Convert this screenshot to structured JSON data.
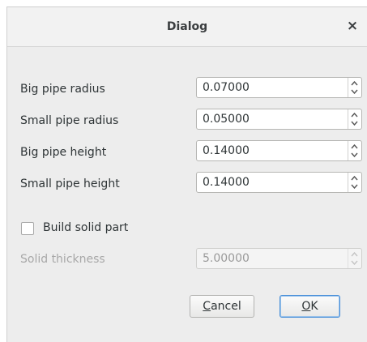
{
  "window": {
    "title": "Dialog",
    "close_glyph": "×"
  },
  "fields": [
    {
      "label": "Big pipe radius",
      "value": "0.07000"
    },
    {
      "label": "Small pipe radius",
      "value": "0.05000"
    },
    {
      "label": "Big pipe height",
      "value": "0.14000"
    },
    {
      "label": "Small pipe height",
      "value": "0.14000"
    }
  ],
  "solid": {
    "checkbox_label": "Build solid part",
    "checked": false,
    "thickness_label": "Solid thickness",
    "thickness_value": "5.00000",
    "thickness_enabled": false
  },
  "buttons": {
    "cancel_mnemonic": "C",
    "cancel_rest": "ancel",
    "ok_mnemonic": "O",
    "ok_rest": "K"
  },
  "icons": {
    "close": "close-icon",
    "spin_up": "arrow-up-icon",
    "spin_down": "arrow-down-icon"
  },
  "colors": {
    "focus_border": "#4a90d9",
    "disabled_text": "#a8a8a8"
  }
}
